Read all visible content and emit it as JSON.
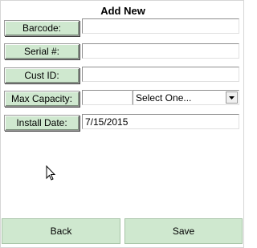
{
  "form": {
    "title": "Add New",
    "rows": [
      {
        "label": "Barcode:",
        "value": ""
      },
      {
        "label": "Serial #:",
        "value": ""
      },
      {
        "label": "Cust ID:",
        "value": ""
      },
      {
        "label": "Max Capacity:",
        "value": ""
      },
      {
        "label": "Install Date:",
        "value": "7/15/2015"
      }
    ],
    "capacity_unit": {
      "selected": "Select One..."
    }
  },
  "footer": {
    "back_label": "Back",
    "save_label": "Save"
  },
  "colors": {
    "button_green": "#cfe8cf"
  },
  "icons": {
    "dropdown": "triangle-down-icon",
    "cursor": "mouse-pointer-icon"
  }
}
